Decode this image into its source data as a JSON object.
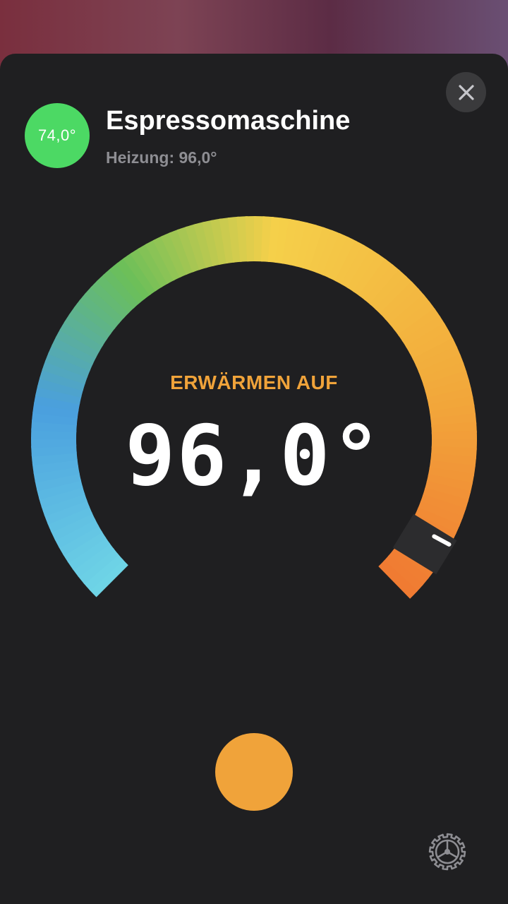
{
  "accessory": {
    "name": "Espressomaschine",
    "current_temperature": "74,0°",
    "subtitle": "Heizung: 96,0°"
  },
  "thermostat": {
    "mode_label": "ERWÄRMEN AUF",
    "target_display": "96,0°",
    "target_level": 0.95
  },
  "colors": {
    "current_badge": "#4cd964",
    "mode_label": "#f0a33a",
    "power_button": "#f0a33a",
    "gradient_cold": "#6fd5e6",
    "gradient_cool": "#4a9fde",
    "gradient_mid": "#6bbf59",
    "gradient_warm": "#f5d04a",
    "gradient_hot": "#f07a32"
  },
  "icons": {
    "close": "close-icon",
    "settings": "gear-icon",
    "power": "power-button"
  }
}
